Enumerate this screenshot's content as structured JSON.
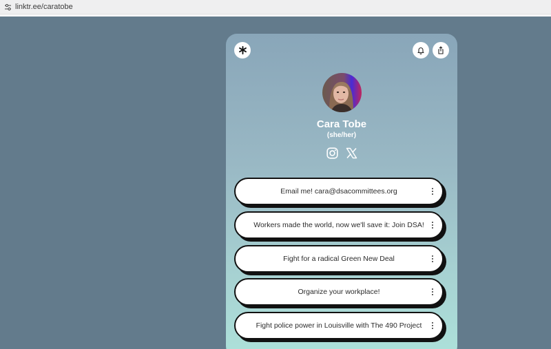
{
  "browser": {
    "url": "linktr.ee/caratobe"
  },
  "profile": {
    "name": "Cara Tobe",
    "pronouns": "(she/her)",
    "avatar_icon": "profile-photo",
    "social": [
      {
        "name": "instagram",
        "icon": "instagram-icon"
      },
      {
        "name": "x",
        "icon": "x-logo-icon"
      }
    ]
  },
  "header": {
    "logo_icon": "linktree-logo-icon",
    "actions": [
      "bell-icon",
      "share-icon"
    ]
  },
  "links": [
    {
      "label": "Email me! cara@dsacommittees.org"
    },
    {
      "label": "Workers made the world, now we'll save it: Join DSA!"
    },
    {
      "label": "Fight for a radical Green New Deal"
    },
    {
      "label": "Organize your workplace!"
    },
    {
      "label": "Fight police power in Louisville with The 490 Project"
    }
  ],
  "colors": {
    "page_bg": "#637b8c",
    "card_top": "#89a6b9",
    "card_bottom": "#ade1da",
    "button_bg": "#ffffff",
    "button_shadow": "#111111"
  }
}
